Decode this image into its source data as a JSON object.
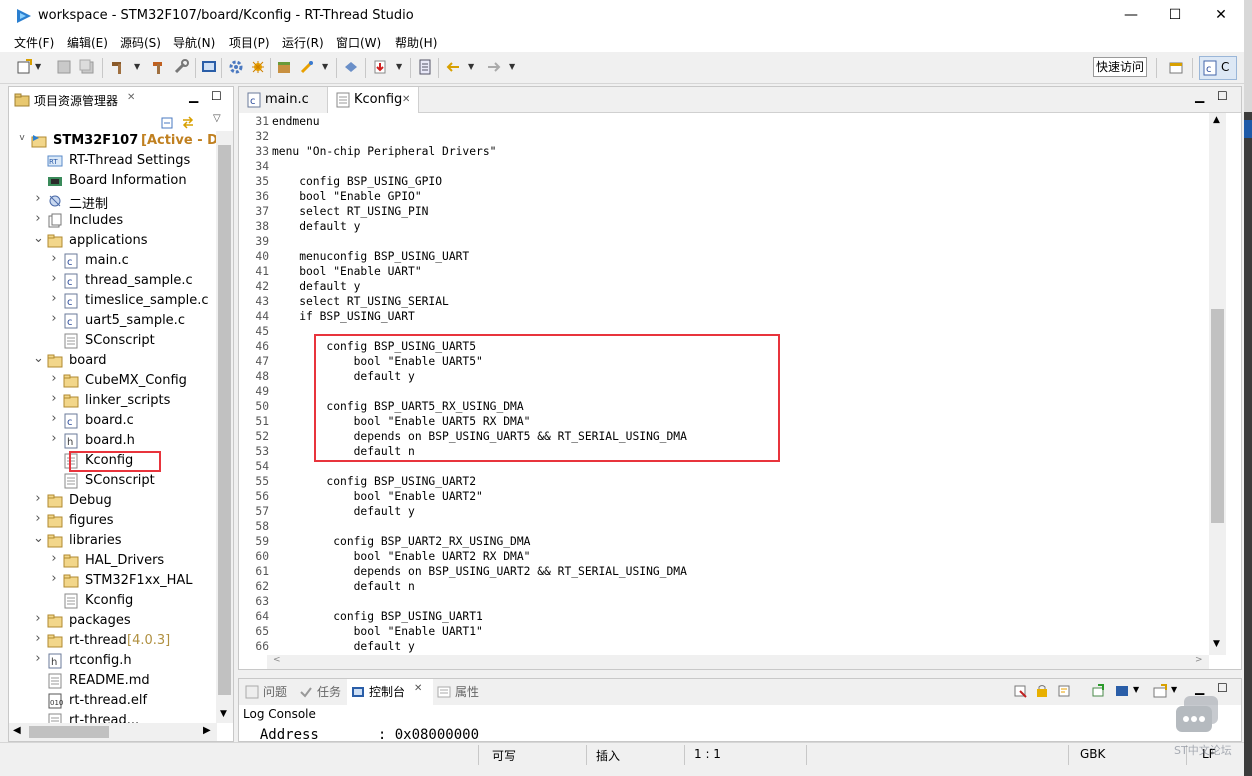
{
  "window": {
    "title": "workspace - STM32F107/board/Kconfig - RT-Thread Studio",
    "minimize": "—",
    "maximize": "☐",
    "close": "✕"
  },
  "menu": [
    "文件(F)",
    "编辑(E)",
    "源码(S)",
    "导航(N)",
    "项目(P)",
    "运行(R)",
    "窗口(W)",
    "帮助(H)"
  ],
  "toolbar": {
    "quick_access": "快速访问",
    "perspective_label": "C"
  },
  "explorer": {
    "title": "项目资源管理器",
    "close": "✕",
    "project": "STM32F107",
    "project_badge": "[Active - De",
    "items": [
      {
        "label": "RT-Thread Settings",
        "icon": "rt-settings-icon"
      },
      {
        "label": "Board Information",
        "icon": "board-info-icon"
      },
      {
        "label": "二进制",
        "icon": "binaries-icon"
      },
      {
        "label": "Includes",
        "icon": "includes-icon"
      },
      {
        "label": "applications",
        "icon": "folder-icon"
      },
      {
        "label": "main.c",
        "icon": "c-file-icon"
      },
      {
        "label": "thread_sample.c",
        "icon": "c-file-icon"
      },
      {
        "label": "timeslice_sample.c",
        "icon": "c-file-icon"
      },
      {
        "label": "uart5_sample.c",
        "icon": "c-file-icon"
      },
      {
        "label": "SConscript",
        "icon": "text-file-icon"
      },
      {
        "label": "board",
        "icon": "folder-icon"
      },
      {
        "label": "CubeMX_Config",
        "icon": "folder-icon"
      },
      {
        "label": "linker_scripts",
        "icon": "folder-icon"
      },
      {
        "label": "board.c",
        "icon": "c-file-icon"
      },
      {
        "label": "board.h",
        "icon": "h-file-icon"
      },
      {
        "label": "Kconfig",
        "icon": "text-file-icon"
      },
      {
        "label": "SConscript",
        "icon": "text-file-icon"
      },
      {
        "label": "Debug",
        "icon": "folder-icon"
      },
      {
        "label": "figures",
        "icon": "folder-icon"
      },
      {
        "label": "libraries",
        "icon": "folder-icon"
      },
      {
        "label": "HAL_Drivers",
        "icon": "folder-icon"
      },
      {
        "label": "STM32F1xx_HAL",
        "icon": "folder-icon"
      },
      {
        "label": "Kconfig",
        "icon": "text-file-icon"
      },
      {
        "label": "packages",
        "icon": "folder-icon"
      },
      {
        "label": "rt-thread",
        "icon": "folder-icon",
        "suffix": "[4.0.3]"
      },
      {
        "label": "rtconfig.h",
        "icon": "h-file-icon"
      },
      {
        "label": "README.md",
        "icon": "text-file-icon"
      },
      {
        "label": "rt-thread.elf",
        "icon": "elf-file-icon"
      },
      {
        "label": "rt-thread...",
        "icon": "text-file-icon"
      }
    ]
  },
  "editor": {
    "tabs": [
      {
        "label": "main.c",
        "active": false
      },
      {
        "label": "Kconfig",
        "active": true
      }
    ],
    "tab_close": "✕",
    "lines": [
      {
        "n": "31",
        "t": "endmenu"
      },
      {
        "n": "32",
        "t": ""
      },
      {
        "n": "33",
        "t": "menu \"On-chip Peripheral Drivers\""
      },
      {
        "n": "34",
        "t": ""
      },
      {
        "n": "35",
        "t": "    config BSP_USING_GPIO"
      },
      {
        "n": "36",
        "t": "    bool \"Enable GPIO\""
      },
      {
        "n": "37",
        "t": "    select RT_USING_PIN"
      },
      {
        "n": "38",
        "t": "    default y"
      },
      {
        "n": "39",
        "t": ""
      },
      {
        "n": "40",
        "t": "    menuconfig BSP_USING_UART"
      },
      {
        "n": "41",
        "t": "    bool \"Enable UART\""
      },
      {
        "n": "42",
        "t": "    default y"
      },
      {
        "n": "43",
        "t": "    select RT_USING_SERIAL"
      },
      {
        "n": "44",
        "t": "    if BSP_USING_UART"
      },
      {
        "n": "45",
        "t": ""
      },
      {
        "n": "46",
        "t": "        config BSP_USING_UART5"
      },
      {
        "n": "47",
        "t": "            bool \"Enable UART5\""
      },
      {
        "n": "48",
        "t": "            default y"
      },
      {
        "n": "49",
        "t": ""
      },
      {
        "n": "50",
        "t": "        config BSP_UART5_RX_USING_DMA"
      },
      {
        "n": "51",
        "t": "            bool \"Enable UART5 RX DMA\""
      },
      {
        "n": "52",
        "t": "            depends on BSP_USING_UART5 && RT_SERIAL_USING_DMA"
      },
      {
        "n": "53",
        "t": "            default n"
      },
      {
        "n": "54",
        "t": ""
      },
      {
        "n": "55",
        "t": "        config BSP_USING_UART2"
      },
      {
        "n": "56",
        "t": "            bool \"Enable UART2\""
      },
      {
        "n": "57",
        "t": "            default y"
      },
      {
        "n": "58",
        "t": ""
      },
      {
        "n": "59",
        "t": "         config BSP_UART2_RX_USING_DMA"
      },
      {
        "n": "60",
        "t": "            bool \"Enable UART2 RX DMA\""
      },
      {
        "n": "61",
        "t": "            depends on BSP_USING_UART2 && RT_SERIAL_USING_DMA"
      },
      {
        "n": "62",
        "t": "            default n"
      },
      {
        "n": "63",
        "t": ""
      },
      {
        "n": "64",
        "t": "         config BSP_USING_UART1"
      },
      {
        "n": "65",
        "t": "            bool \"Enable UART1\""
      },
      {
        "n": "66",
        "t": "            default y"
      }
    ]
  },
  "bottom_panel": {
    "tabs": [
      "问题",
      "任务",
      "控制台",
      "属性"
    ],
    "active_tab": "控制台",
    "close": "✕",
    "console_name": "Log Console",
    "partial_line": "  Address       : 0x08000000"
  },
  "statusbar": {
    "writable": "可写",
    "insert_mode": "插入",
    "position": "1 : 1",
    "encoding": "GBK",
    "line_ending": "LF"
  },
  "watermark": "ST中文论坛",
  "colors": {
    "highlight_red": "#e8343c",
    "badge_orange": "#c08020",
    "version_gold": "#b09040",
    "accent_blue": "#1e5aa8"
  }
}
